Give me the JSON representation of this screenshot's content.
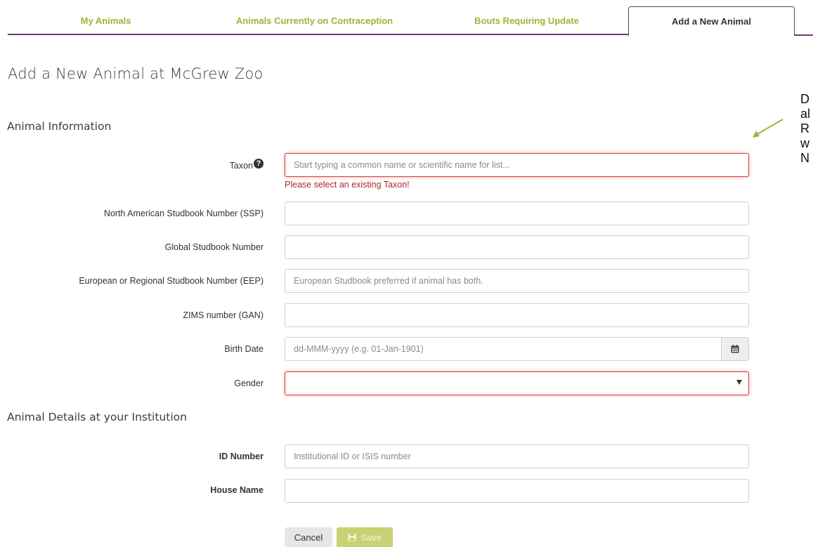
{
  "tabs": [
    {
      "label": "My Animals",
      "active": false
    },
    {
      "label": "Animals Currently on Contraception",
      "active": false
    },
    {
      "label": "Bouts Requiring Update",
      "active": false
    },
    {
      "label": "Add a New Animal",
      "active": true
    }
  ],
  "page_title": "Add a New Animal at McGrew Zoo",
  "sections": {
    "animal_info": "Animal Information",
    "details": "Animal Details at your Institution"
  },
  "form": {
    "taxon": {
      "label": "Taxon",
      "placeholder": "Start typing a common name or scientific name for list...",
      "error": "Please select an existing Taxon!"
    },
    "ssp": {
      "label": "North American Studbook Number (SSP)",
      "value": ""
    },
    "global": {
      "label": "Global Studbook Number",
      "value": ""
    },
    "eep": {
      "label": "European or Regional Studbook Number (EEP)",
      "placeholder": "European Studbook preferred if animal has both."
    },
    "zims": {
      "label": "ZIMS number (GAN)",
      "value": ""
    },
    "birth_date": {
      "label": "Birth Date",
      "placeholder": "dd-MMM-yyyy (e.g. 01-Jan-1901)"
    },
    "gender": {
      "label": "Gender",
      "value": ""
    },
    "id_number": {
      "label": "ID Number",
      "placeholder": "Institutional ID or ISIS number"
    },
    "house_name": {
      "label": "House Name",
      "value": ""
    }
  },
  "buttons": {
    "cancel": "Cancel",
    "save": "Save"
  },
  "annotation_lines": [
    "D",
    "al",
    "R",
    "w",
    "N"
  ],
  "colors": {
    "accent": "#a5b135",
    "tab_border": "#6a3c6d",
    "error": "#e0393e",
    "save_bg": "#c8d173"
  },
  "icons": {
    "help": "question-circle-icon",
    "calendar": "calendar-icon",
    "save": "floppy-disk-icon",
    "dropdown": "caret-down-icon",
    "arrow": "annotation-arrow-icon"
  }
}
